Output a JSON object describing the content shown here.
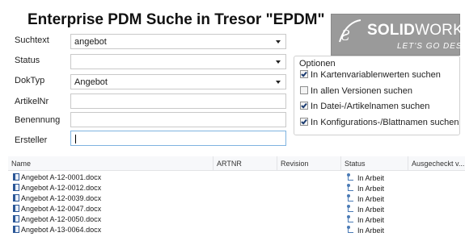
{
  "title": "Enterprise PDM Suche in Tresor \"EPDM\"",
  "logo": {
    "brand_bold": "SOLID",
    "brand_light": "WORKS",
    "tagline": "LET'S GO DESIGN",
    "bg_color": "#9a9a9a"
  },
  "form": {
    "suchtext": {
      "label": "Suchtext",
      "value": "angebot"
    },
    "status": {
      "label": "Status",
      "value": ""
    },
    "doktyp": {
      "label": "DokTyp",
      "value": "Angebot"
    },
    "artikelnr": {
      "label": "ArtikelNr",
      "value": ""
    },
    "benennung": {
      "label": "Benennung",
      "value": ""
    },
    "ersteller": {
      "label": "Ersteller",
      "value": ""
    }
  },
  "options": {
    "legend": "Optionen",
    "items": [
      {
        "label": "In Kartenvariablenwerten suchen",
        "checked": true
      },
      {
        "label": "In allen Versionen suchen",
        "checked": false
      },
      {
        "label": "In Datei-/Artikelnamen suchen",
        "checked": true
      },
      {
        "label": "In Konfigurations-/Blattnamen suchen",
        "checked": true
      }
    ]
  },
  "results": {
    "columns": [
      "Name",
      "ARTNR",
      "Revision",
      "Status",
      "Ausgecheckt v..."
    ],
    "rows": [
      {
        "name": "Angebot A-12-0001.docx",
        "artnr": "",
        "revision": "",
        "status": "In Arbeit"
      },
      {
        "name": "Angebot A-12-0012.docx",
        "artnr": "",
        "revision": "",
        "status": "In Arbeit"
      },
      {
        "name": "Angebot A-12-0039.docx",
        "artnr": "",
        "revision": "",
        "status": "In Arbeit"
      },
      {
        "name": "Angebot A-12-0047.docx",
        "artnr": "",
        "revision": "",
        "status": "In Arbeit"
      },
      {
        "name": "Angebot A-12-0050.docx",
        "artnr": "",
        "revision": "",
        "status": "In Arbeit"
      },
      {
        "name": "Angebot A-13-0064.docx",
        "artnr": "",
        "revision": "",
        "status": "In Arbeit"
      }
    ]
  }
}
